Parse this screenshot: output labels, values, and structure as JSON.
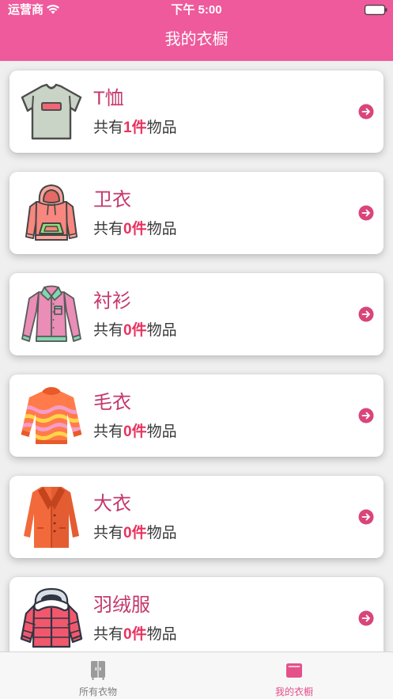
{
  "status_bar": {
    "carrier": "运营商",
    "time": "下午 5:00",
    "wifi_icon": "wifi-icon",
    "battery_icon": "battery-icon"
  },
  "nav": {
    "title": "我的衣橱"
  },
  "categories": [
    {
      "title": "T恤",
      "prefix": "共有",
      "count": "1",
      "unit": "件",
      "suffix": "物品",
      "icon": "tshirt-icon"
    },
    {
      "title": "卫衣",
      "prefix": "共有",
      "count": "0",
      "unit": "件",
      "suffix": "物品",
      "icon": "hoodie-icon"
    },
    {
      "title": "衬衫",
      "prefix": "共有",
      "count": "0",
      "unit": "件",
      "suffix": "物品",
      "icon": "shirt-icon"
    },
    {
      "title": "毛衣",
      "prefix": "共有",
      "count": "0",
      "unit": "件",
      "suffix": "物品",
      "icon": "sweater-icon"
    },
    {
      "title": "大衣",
      "prefix": "共有",
      "count": "0",
      "unit": "件",
      "suffix": "物品",
      "icon": "coat-icon"
    },
    {
      "title": "羽绒服",
      "prefix": "共有",
      "count": "0",
      "unit": "件",
      "suffix": "物品",
      "icon": "down-jacket-icon"
    }
  ],
  "card_action_icon": "arrow-right-circle-icon",
  "tabs": [
    {
      "label": "所有衣物",
      "icon": "wardrobe-icon",
      "selected": false
    },
    {
      "label": "我的衣橱",
      "icon": "box-icon",
      "selected": true
    }
  ],
  "colors": {
    "header": "#EE5A9B",
    "category_title": "#C4386C",
    "count_highlight": "#E8325E",
    "arrow": "#D9457B",
    "tab_active": "#E4508A",
    "tab_inactive": "#7F7F7F",
    "background": "#EFEFEF"
  }
}
